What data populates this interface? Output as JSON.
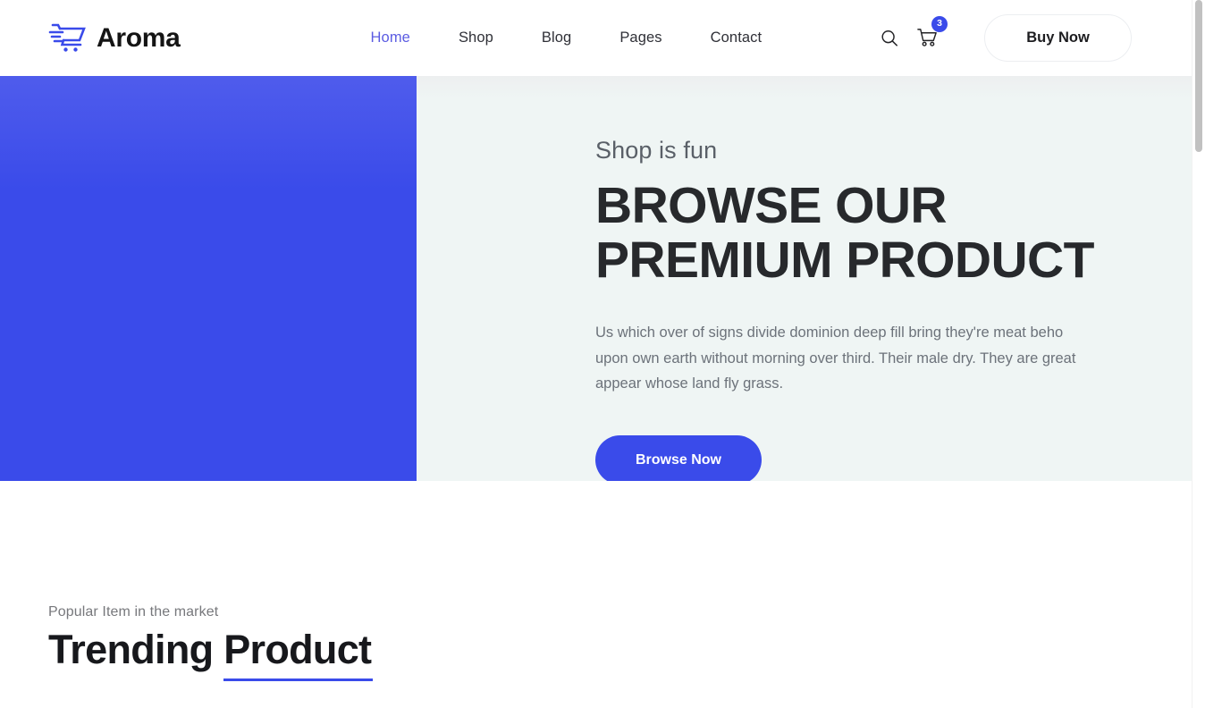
{
  "colors": {
    "brand_blue": "#3a4bea",
    "nav_active": "#5b5ce2",
    "hero_bg": "#eff5f4",
    "heading_dark": "#27292c",
    "body_text": "#6c727a"
  },
  "header": {
    "logo_icon": "shopping-cart-icon",
    "brand_name": "Aroma",
    "nav": [
      {
        "label": "Home",
        "active": true
      },
      {
        "label": "Shop",
        "active": false
      },
      {
        "label": "Blog",
        "active": false
      },
      {
        "label": "Pages",
        "active": false
      },
      {
        "label": "Contact",
        "active": false
      }
    ],
    "search_icon": "search-icon",
    "cart_icon": "cart-icon",
    "cart_count": "3",
    "buy_now_label": "Buy Now"
  },
  "hero": {
    "eyebrow": "Shop is fun",
    "title_line1": "BROWSE OUR",
    "title_line2": "PREMIUM PRODUCT",
    "paragraph": "Us which over of signs divide dominion deep fill bring they're meat beho upon own earth without morning over third. Their male dry. They are great appear whose land fly grass.",
    "cta_label": "Browse Now"
  },
  "trending": {
    "eyebrow": "Popular Item in the market",
    "title_prefix": "Trending ",
    "title_highlight": "Product"
  }
}
